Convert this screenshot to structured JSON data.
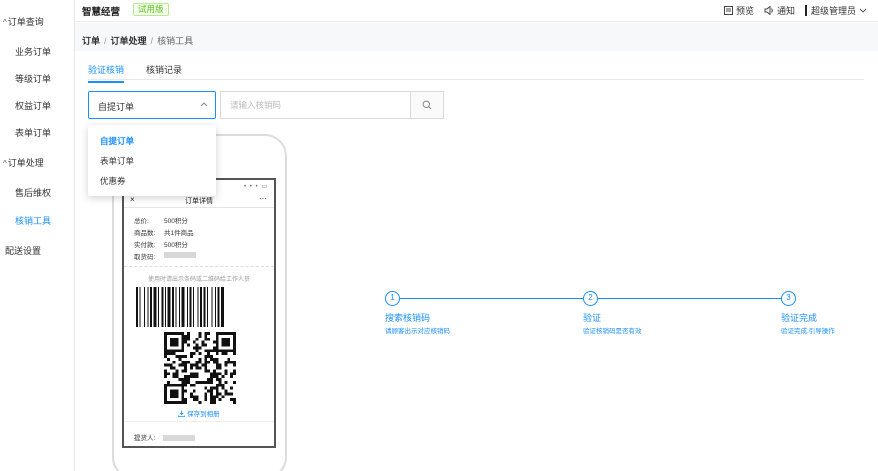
{
  "app": {
    "title": "智慧经营",
    "badge": "试用版"
  },
  "header": {
    "preview_label": "预览",
    "notify_label": "通知",
    "user_label": "超级管理员"
  },
  "sidebar": {
    "groups": [
      {
        "label": "订单查询",
        "items": [
          "业务订单",
          "等级订单",
          "权益订单",
          "表单订单"
        ]
      },
      {
        "label": "订单处理",
        "items": [
          "售后维权",
          "核销工具"
        ]
      }
    ],
    "bottom": "配送设置",
    "active_item": "核销工具"
  },
  "breadcrumb": {
    "level1": "订单",
    "level2": "订单处理",
    "current": "核销工具"
  },
  "tabs": [
    {
      "label": "验证核销",
      "active": true
    },
    {
      "label": "核销记录",
      "active": false
    }
  ],
  "search": {
    "select_value": "自提订单",
    "placeholder": "请输入核销码",
    "options": [
      "自提订单",
      "表单订单",
      "优惠券"
    ]
  },
  "phone": {
    "status": "• • • ▭",
    "page_title": "订单详情",
    "close_icon": "×",
    "more_icon": "···",
    "rows": [
      {
        "k": "总价:",
        "v": "500积分"
      },
      {
        "k": "商品数:",
        "v": "共1件商品"
      },
      {
        "k": "实付款:",
        "v": "500积分"
      },
      {
        "k": "取货码:",
        "v": ""
      }
    ],
    "tip": "使用时请出示条码或二维码给工作人员",
    "save_label": "保存到相册",
    "picker_label": "提货人:"
  },
  "steps": [
    {
      "num": "1",
      "title": "搜索核销码",
      "desc": "请顾客出示对应核销码"
    },
    {
      "num": "2",
      "title": "验证",
      "desc": "验证核销码是否有效"
    },
    {
      "num": "3",
      "title": "验证完成",
      "desc": "验证完成,引导操作"
    }
  ],
  "colors": {
    "accent": "#1890ff",
    "trial_green": "#52c41a"
  }
}
